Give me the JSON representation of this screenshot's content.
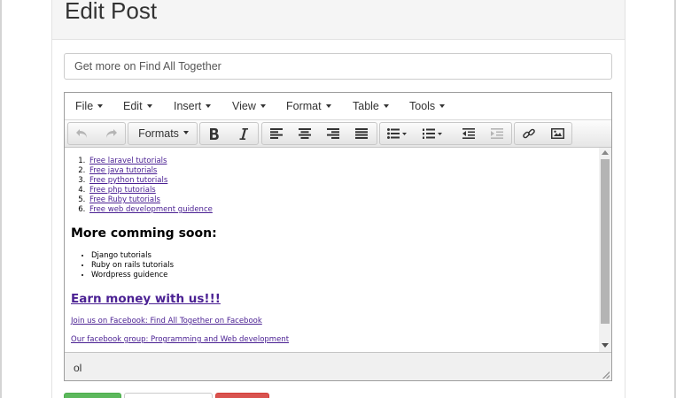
{
  "page": {
    "title": "Edit Post"
  },
  "form": {
    "title_value": "Get more on Find All Together"
  },
  "editor": {
    "menu": [
      "File",
      "Edit",
      "Insert",
      "View",
      "Format",
      "Table",
      "Tools"
    ],
    "formats_label": "Formats",
    "content": {
      "ordered_links": [
        "Free laravel tutorials",
        "Free java tutorials",
        "Free python tutorials",
        "Free php tutorials",
        "Free Ruby tutorials",
        "Free web development guidence"
      ],
      "heading": "More comming soon:",
      "bullets": [
        "Django tutorials",
        "Ruby on rails tutorials",
        "Wordpress guidence"
      ],
      "earn_link": "Earn money with us!!!",
      "facebook_link": "Join us on Facebook: Find All Together on Facebook",
      "group_link": "Our facebook group: Programming and Web development"
    },
    "status_path": "ol"
  },
  "icons": {
    "undo": "undo-icon",
    "redo": "redo-icon",
    "bold": "bold-icon",
    "italic": "italic-icon",
    "align_left": "align-left-icon",
    "align_center": "align-center-icon",
    "align_right": "align-right-icon",
    "align_justify": "align-justify-icon",
    "bullet_list": "bullet-list-icon",
    "numbered_list": "numbered-list-icon",
    "outdent": "outdent-icon",
    "indent": "indent-icon",
    "link": "link-icon",
    "image": "image-icon"
  },
  "colors": {
    "link": "#4b2193",
    "success": "#5cb85c",
    "danger": "#d9534f"
  }
}
